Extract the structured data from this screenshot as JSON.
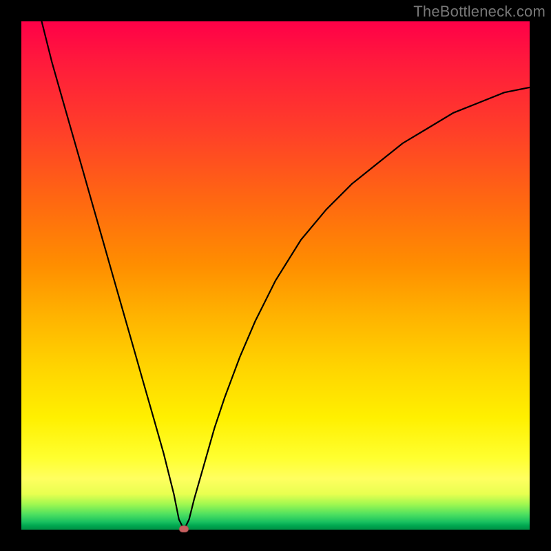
{
  "watermark": "TheBottleneck.com",
  "chart_data": {
    "type": "line",
    "title": "",
    "xlabel": "",
    "ylabel": "",
    "xlim": [
      0,
      100
    ],
    "ylim": [
      0,
      100
    ],
    "grid": false,
    "legend": false,
    "background_gradient": {
      "top": "#ff0048",
      "middle": "#ffd400",
      "bottom": "#009045"
    },
    "series": [
      {
        "name": "bottleneck-curve",
        "x": [
          4,
          6,
          8,
          10,
          12,
          14,
          16,
          18,
          20,
          22,
          24,
          26,
          28,
          30,
          31,
          32,
          33,
          34,
          36,
          38,
          40,
          43,
          46,
          50,
          55,
          60,
          65,
          70,
          75,
          80,
          85,
          90,
          95,
          100
        ],
        "values": [
          100,
          92,
          85,
          78,
          71,
          64,
          57,
          50,
          43,
          36,
          29,
          22,
          15,
          7,
          2,
          0,
          2,
          6,
          13,
          20,
          26,
          34,
          41,
          49,
          57,
          63,
          68,
          72,
          76,
          79,
          82,
          84,
          86,
          87
        ]
      }
    ],
    "marker": {
      "name": "bottleneck-minimum",
      "x": 32,
      "y": 0,
      "color": "#c86060"
    }
  }
}
